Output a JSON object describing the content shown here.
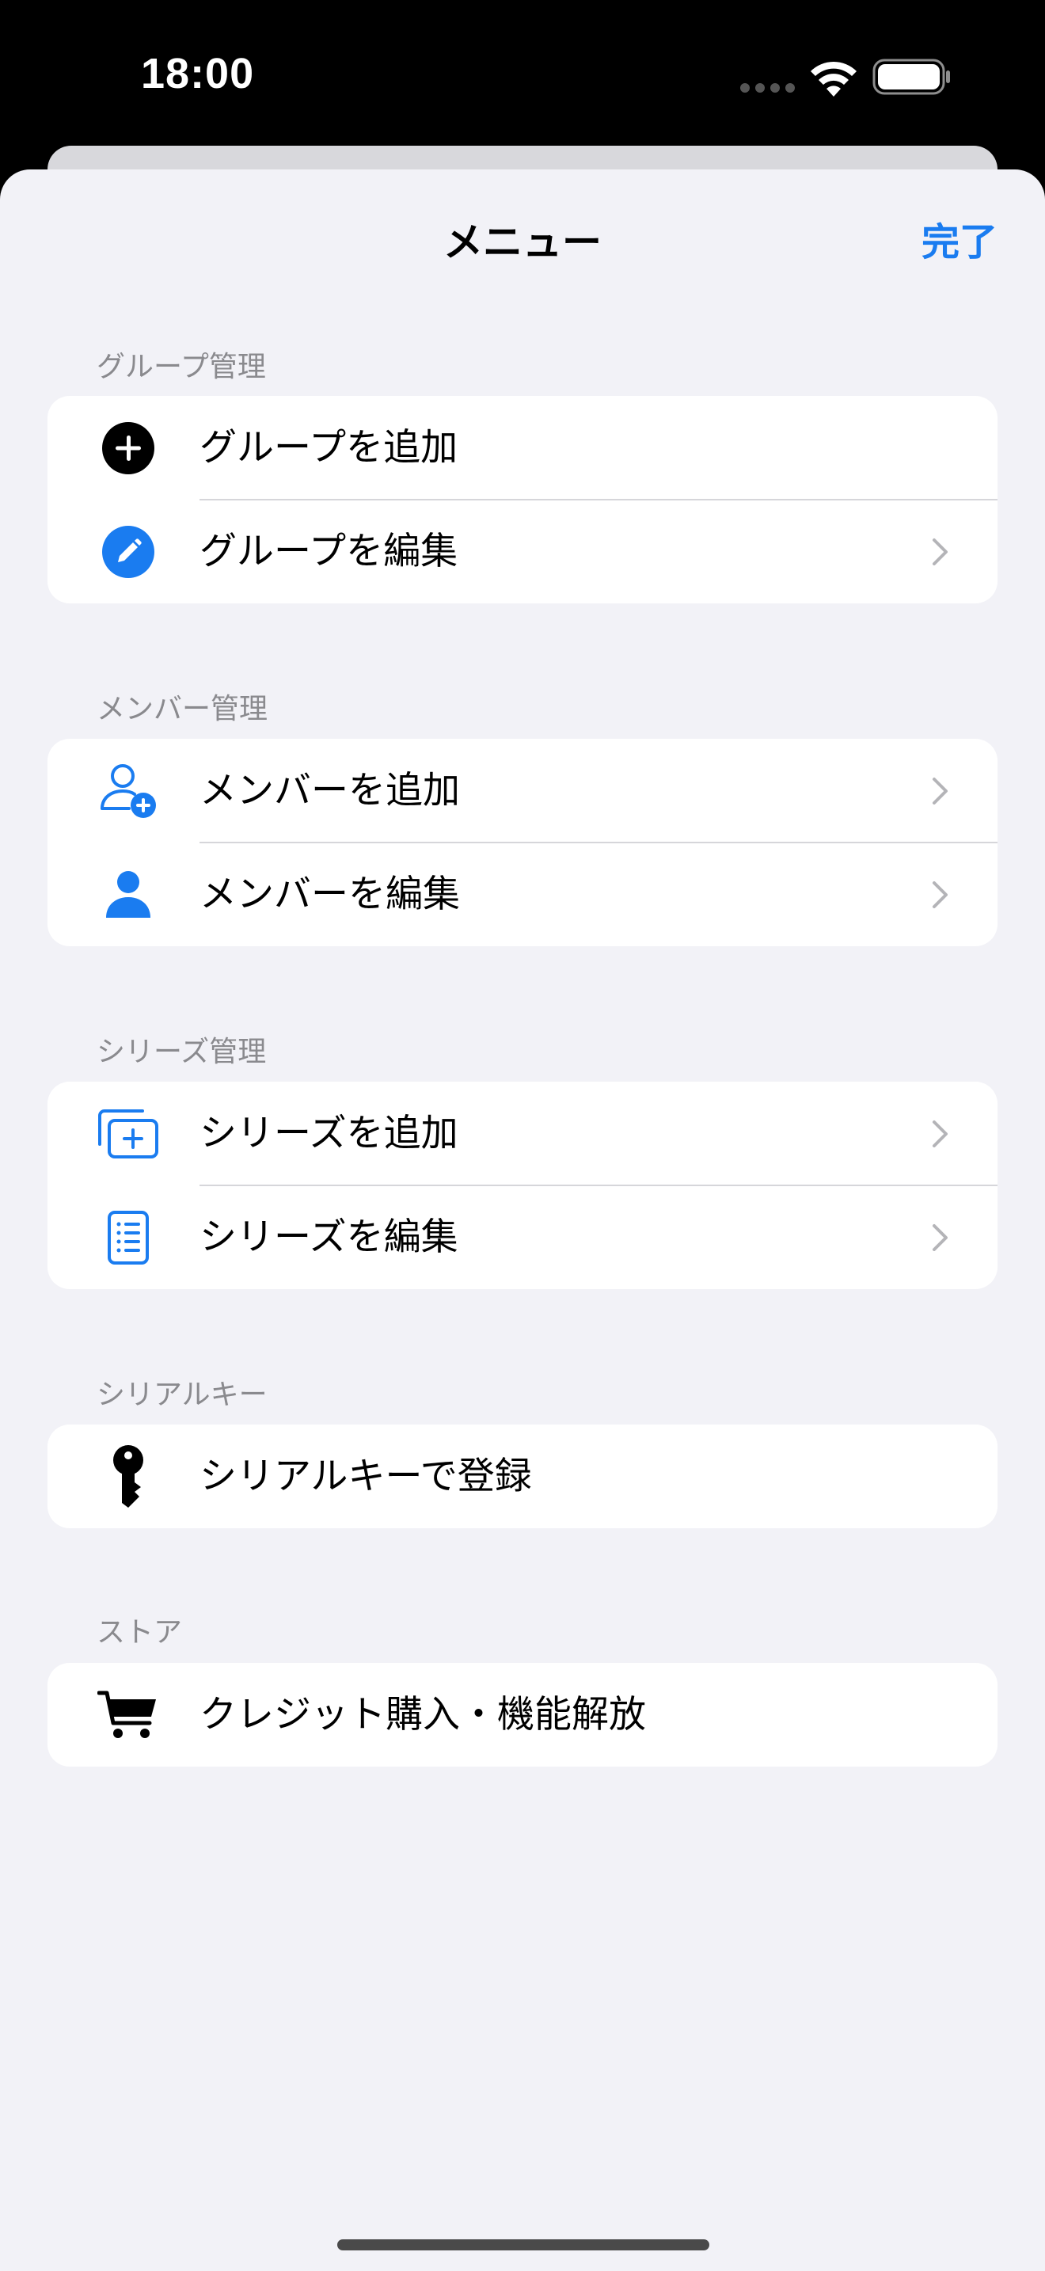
{
  "status_bar": {
    "time": "18:00"
  },
  "nav": {
    "title": "メニュー",
    "done_label": "完了"
  },
  "sections": [
    {
      "header": "グループ管理",
      "items": [
        {
          "label": "グループを追加",
          "icon": "plus-circle-icon"
        },
        {
          "label": "グループを編集",
          "icon": "pencil-circle-icon"
        }
      ]
    },
    {
      "header": "メンバー管理",
      "items": [
        {
          "label": "メンバーを追加",
          "icon": "person-badge-plus-icon"
        },
        {
          "label": "メンバーを編集",
          "icon": "person-icon"
        }
      ]
    },
    {
      "header": "シリーズ管理",
      "items": [
        {
          "label": "シリーズを追加",
          "icon": "square-stack-plus-icon"
        },
        {
          "label": "シリーズを編集",
          "icon": "list-document-icon"
        }
      ]
    },
    {
      "header": "シリアルキー",
      "items": [
        {
          "label": "シリアルキーで登録",
          "icon": "key-icon"
        }
      ]
    },
    {
      "header": "ストア",
      "items": [
        {
          "label": "クレジット購入・機能解放",
          "icon": "cart-icon"
        }
      ]
    }
  ],
  "colors": {
    "accent": "#1a7cf0",
    "background": "#f2f2f7",
    "card": "#ffffff",
    "section_header": "#8a8a8e"
  }
}
